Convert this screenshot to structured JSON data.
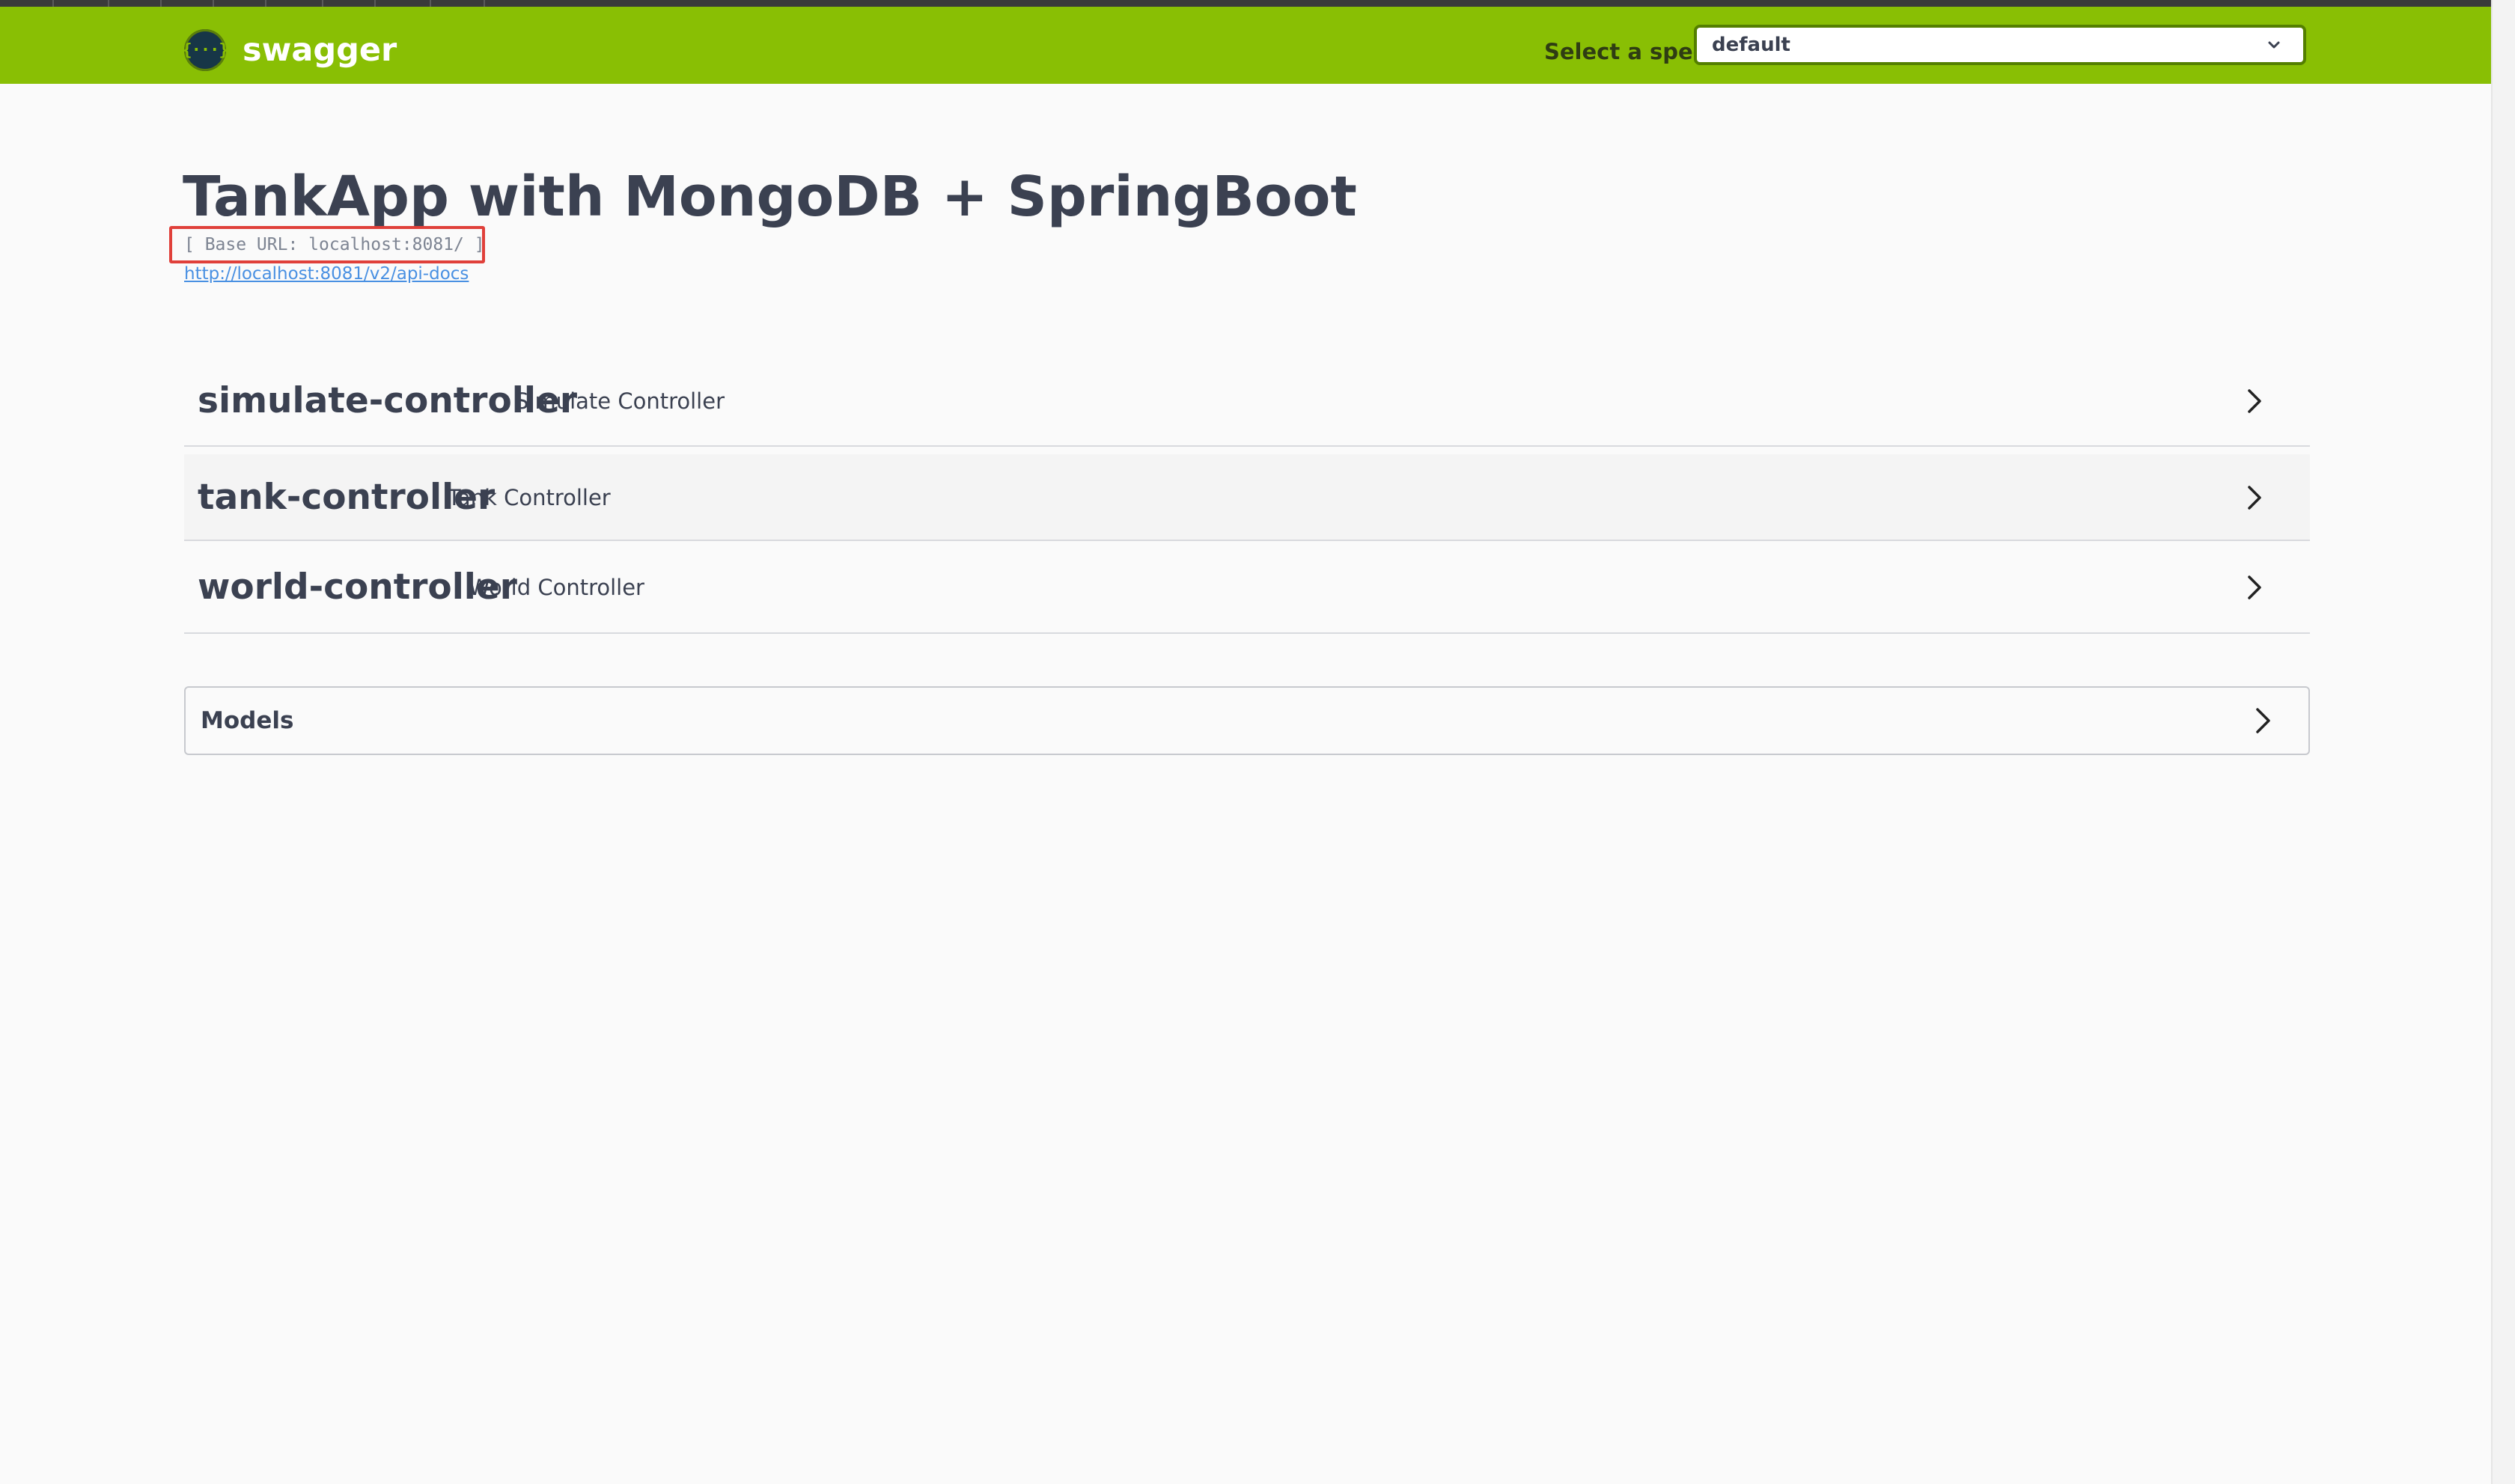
{
  "header": {
    "brand": "swagger",
    "logo_glyph": "{···}",
    "spec_label": "Select a spec",
    "spec_selected": "default"
  },
  "info": {
    "title": "TankApp with MongoDB + SpringBoot",
    "base_url": "[ Base URL: localhost:8081/ ]",
    "docs_link": "http://localhost:8081/v2/api-docs"
  },
  "tags": [
    {
      "name": "simulate-controller",
      "description": "Simulate Controller"
    },
    {
      "name": "tank-controller",
      "description": "Tank Controller"
    },
    {
      "name": "world-controller",
      "description": "World Controller"
    }
  ],
  "models": {
    "label": "Models"
  },
  "colors": {
    "topbar": "#89bf04",
    "text": "#3b4151",
    "link": "#4990e2",
    "highlight": "#e0403a"
  },
  "icons": {
    "logo": "swagger-logo-icon",
    "dropdown": "chevron-down-icon",
    "expand": "chevron-right-icon"
  }
}
